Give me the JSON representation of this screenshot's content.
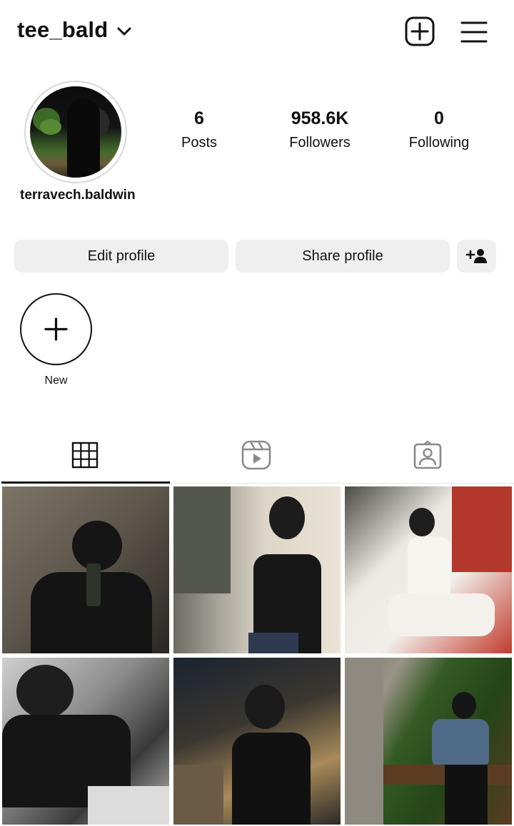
{
  "header": {
    "username": "tee_bald"
  },
  "profile": {
    "full_name": "terravech.baldwin",
    "stats": [
      {
        "value": "6",
        "label": "Posts"
      },
      {
        "value": "958.6K",
        "label": "Followers"
      },
      {
        "value": "0",
        "label": "Following"
      }
    ]
  },
  "actions": {
    "edit_label": "Edit profile",
    "share_label": "Share profile"
  },
  "highlights": {
    "new_label": "New"
  },
  "tabs": [
    {
      "icon": "grid-icon",
      "active": true
    },
    {
      "icon": "reels-icon",
      "active": false
    },
    {
      "icon": "tagged-icon",
      "active": false
    }
  ],
  "posts": [
    {
      "icon": "photo"
    },
    {
      "icon": "photo"
    },
    {
      "icon": "photo"
    },
    {
      "icon": "photo"
    },
    {
      "icon": "photo"
    },
    {
      "icon": "photo"
    }
  ]
}
